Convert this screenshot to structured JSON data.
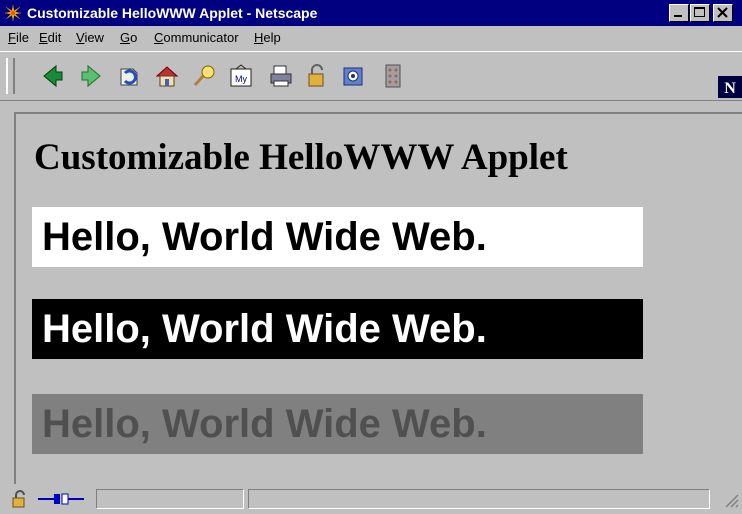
{
  "window": {
    "title": "Customizable HelloWWW Applet - Netscape"
  },
  "menu": {
    "items": [
      {
        "key": "F",
        "rest": "ile"
      },
      {
        "key": "E",
        "rest": "dit"
      },
      {
        "key": "V",
        "rest": "iew"
      },
      {
        "key": "G",
        "rest": "o"
      },
      {
        "key": "C",
        "rest": "ommunicator"
      },
      {
        "key": "H",
        "rest": "elp"
      }
    ]
  },
  "toolbar": {
    "buttons": [
      "back-icon",
      "forward-icon",
      "reload-icon",
      "home-icon",
      "search-icon",
      "my-netscape-icon",
      "print-icon",
      "security-icon",
      "shop-icon",
      "stop-icon"
    ],
    "my_label": "My",
    "logo": "N"
  },
  "page": {
    "heading": "Customizable HelloWWW Applet",
    "applets": [
      {
        "text": "Hello, World Wide Web.",
        "background": "#ffffff",
        "color": "#000000"
      },
      {
        "text": "Hello, World Wide Web.",
        "background": "#000000",
        "color": "#ffffff"
      },
      {
        "text": "Hello, World Wide Web.",
        "background": "#808080",
        "color": "#505050"
      }
    ]
  },
  "status": {
    "text": ""
  }
}
